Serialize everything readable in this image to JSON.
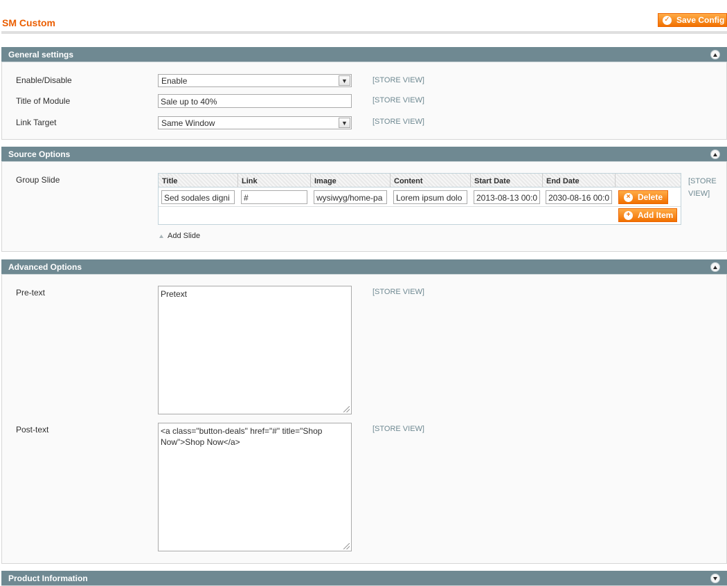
{
  "page": {
    "title": "SM Custom",
    "save_label": "Save Config"
  },
  "colors": {
    "accent": "#eb5e00",
    "button": "#f17000",
    "section_header": "#6f8992",
    "scope_text": "#6f8992"
  },
  "sections": {
    "general": {
      "title": "General settings",
      "fields": {
        "enable": {
          "label": "Enable/Disable",
          "value": "Enable",
          "scope": "[STORE VIEW]"
        },
        "title": {
          "label": "Title of Module",
          "value": "Sale up to 40%",
          "scope": "[STORE VIEW]"
        },
        "target": {
          "label": "Link Target",
          "value": "Same Window",
          "scope": "[STORE VIEW]"
        }
      }
    },
    "source": {
      "title": "Source Options",
      "group_label": "Group Slide",
      "scope_line1": "[STORE",
      "scope_line2": "VIEW]",
      "columns": [
        "Title",
        "Link",
        "Image",
        "Content",
        "Start Date",
        "End Date"
      ],
      "row": [
        "Sed sodales digni",
        "#",
        "wysiwyg/home-pa",
        "Lorem ipsum dolo",
        "2013-08-13 00:0",
        "2030-08-16 00:0"
      ],
      "delete_label": "Delete",
      "add_item_label": "Add Item",
      "add_slide_label": "Add Slide"
    },
    "advanced": {
      "title": "Advanced Options",
      "pretext": {
        "label": "Pre-text",
        "value": "Pretext",
        "scope": "[STORE VIEW]"
      },
      "posttext": {
        "label": "Post-text",
        "value": "<a class=\"button-deals\" href=\"#\" title=\"Shop Now\">Shop Now</a>",
        "scope": "[STORE VIEW]"
      }
    },
    "product": {
      "title": "Product Information"
    }
  },
  "icons": {
    "save": "check-circle-icon",
    "collapse": "chevron-up-circle-icon",
    "expand": "chevron-down-circle-icon",
    "delete": "x-circle-icon",
    "add": "plus-circle-icon",
    "select_arrow": "chevron-down-icon"
  }
}
